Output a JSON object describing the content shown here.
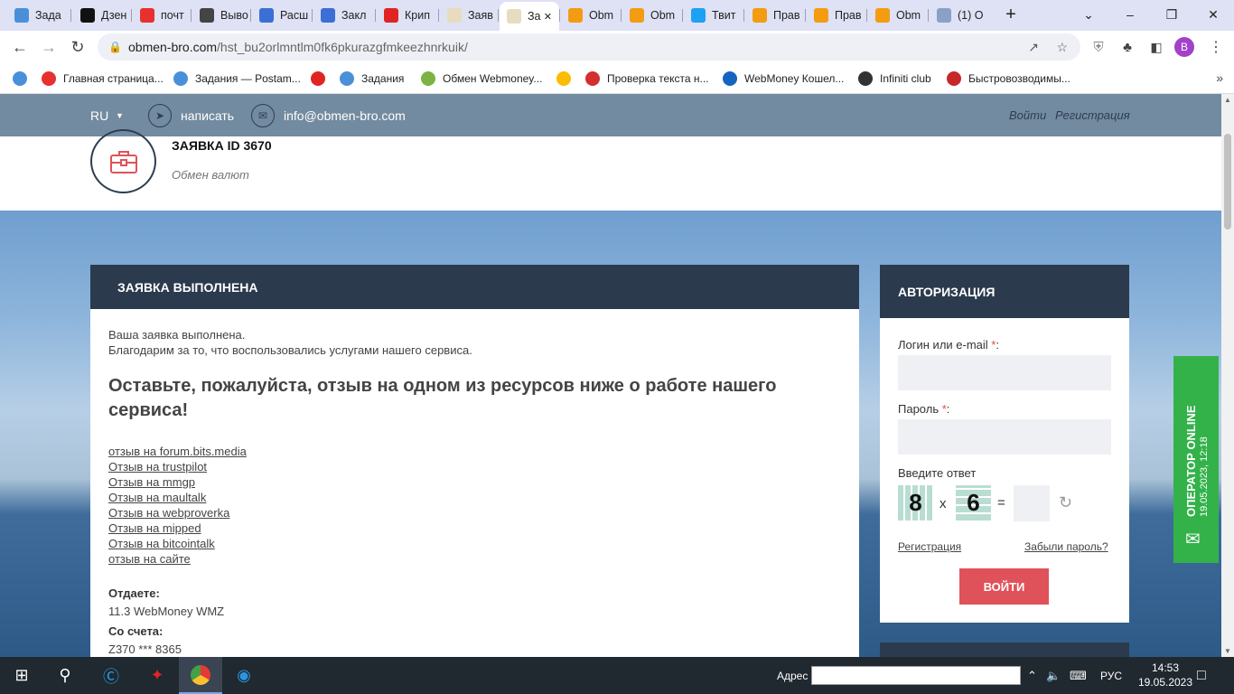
{
  "browser": {
    "tabs": [
      {
        "label": "Зада",
        "color": "#4a90d9"
      },
      {
        "label": "Дзен",
        "color": "#111"
      },
      {
        "label": "почт",
        "color": "#e6312f"
      },
      {
        "label": "Выво",
        "color": "#444"
      },
      {
        "label": "Расш",
        "color": "#3b6fd6"
      },
      {
        "label": "Закл",
        "color": "#3b6fd6"
      },
      {
        "label": "Крип",
        "color": "#e02424"
      },
      {
        "label": "Заяв",
        "color": "#e8dcc0"
      },
      {
        "label": "За",
        "color": "#e8dcc0"
      },
      {
        "label": "Obm",
        "color": "#f39c12"
      },
      {
        "label": "Obm",
        "color": "#f39c12"
      },
      {
        "label": "Твит",
        "color": "#1da1f2"
      },
      {
        "label": "Прав",
        "color": "#f39c12"
      },
      {
        "label": "Прав",
        "color": "#f39c12"
      },
      {
        "label": "Obm",
        "color": "#f39c12"
      },
      {
        "label": "(1) O",
        "color": "#8aa1c7"
      }
    ],
    "url_domain": "obmen-bro.com",
    "url_path": "/hst_bu2orlmntlm0fk6pkurazgfmkeezhnrkuik/",
    "profile_initial": "B",
    "bookmarks": [
      {
        "label": "",
        "color": "#4a90d9"
      },
      {
        "label": "Главная страница...",
        "color": "#e6312f"
      },
      {
        "label": "Задания — Postam...",
        "color": "#4a90d9"
      },
      {
        "label": "",
        "color": "#e02424"
      },
      {
        "label": "Задания",
        "color": "#4a90d9"
      },
      {
        "label": "Обмен Webmoney...",
        "color": "#7cb342"
      },
      {
        "label": "",
        "color": "#fbbc04"
      },
      {
        "label": "Проверка текста н...",
        "color": "#d32f2f"
      },
      {
        "label": "WebMoney Кошел...",
        "color": "#1565c0"
      },
      {
        "label": "Infiniti club",
        "color": "#333"
      },
      {
        "label": "Быстровозводимы...",
        "color": "#c62828"
      }
    ]
  },
  "site": {
    "lang": "RU",
    "write_label": "написать",
    "email": "info@obmen-bro.com",
    "login_link": "Войти",
    "register_link": "Регистрация",
    "order_title": "ЗАЯВКА ID 3670",
    "order_subtitle": "Обмен валют"
  },
  "main": {
    "header": "ЗАЯВКА ВЫПОЛНЕНА",
    "line1": "Ваша заявка выполнена.",
    "line2": "Благодарим за то, что воспользовались услугами нашего сервиса.",
    "heading": "Оставьте, пожалуйста, отзыв на одном из ресурсов ниже о работе нашего сервиса!",
    "links": [
      "отзыв на forum.bits.media",
      "Отзыв на trustpilot",
      "Отзыв на mmgp",
      "Отзыв на maultalk",
      "Отзыв на webproverka",
      "Отзыв на mipped",
      "Отзыв на bitcointalk",
      "отзыв на сайте"
    ],
    "give_label": "Отдаете:",
    "give_value": "11.3 WebMoney WMZ",
    "from_label": "Со счета:",
    "from_value": "Z370 *** 8365"
  },
  "auth": {
    "header": "АВТОРИЗАЦИЯ",
    "login_label": "Логин или e-mail",
    "password_label": "Пароль",
    "required_mark": "*",
    "colon": ":",
    "captcha_label": "Введите ответ",
    "captcha_a": "8",
    "captcha_op": "x",
    "captcha_b": "6",
    "captcha_eq": "=",
    "register": "Регистрация",
    "forgot": "Забыли пароль?",
    "submit": "ВОЙТИ"
  },
  "operator": {
    "title": "ОПЕРАТОР ONLINE",
    "time": "19.05.2023, 12:18"
  },
  "taskbar": {
    "address_label": "Адрес",
    "lang": "РУС",
    "time": "14:53",
    "date": "19.05.2023"
  }
}
